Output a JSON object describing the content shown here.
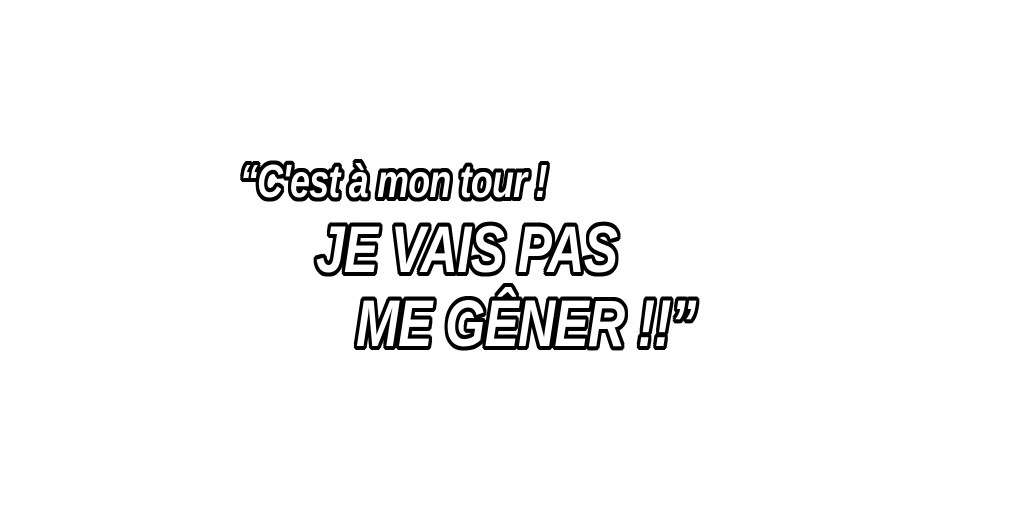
{
  "speech": {
    "line1": "“C'est à mon tour !",
    "line2": "JE VAIS PAS",
    "line3": "ME GÊNER !!”"
  },
  "colors": {
    "background": "#ffffff",
    "text_fill": "#ffffff",
    "text_outline": "#000000"
  }
}
